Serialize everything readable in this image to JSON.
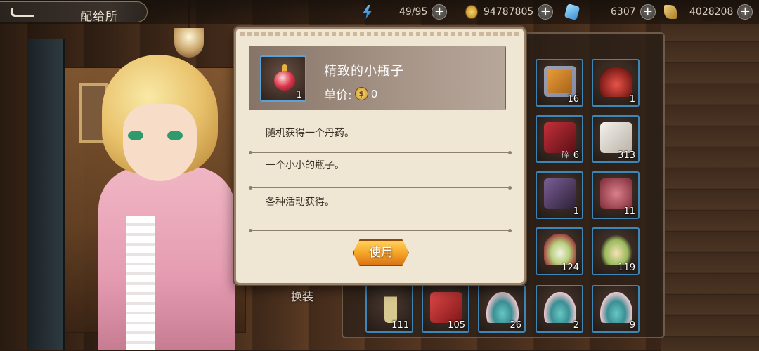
{
  "topbar": {
    "title": "配给所",
    "energy": "49/95",
    "coins": "94787805",
    "gems": "6307",
    "tokens": "4028208"
  },
  "popup": {
    "item_name": "精致的小瓶子",
    "item_qty": "1",
    "price_label": "单价:",
    "price_value": "0",
    "descriptions": [
      "随机获得一个丹药。",
      "一个小小的瓶子。",
      "各种活动获得。"
    ],
    "use_label": "使用"
  },
  "change_outfit_label": "换装",
  "inventory": [
    {
      "icon": "gift-box-icon",
      "count": "16"
    },
    {
      "icon": "potion-bottle-icon",
      "count": "1"
    },
    {
      "icon": "red-package-icon",
      "count": "6",
      "tag": "碎"
    },
    {
      "icon": "dice-icon",
      "count": "313"
    },
    {
      "icon": "blade-icon",
      "count": "1"
    },
    {
      "icon": "gourd-icon",
      "count": "11"
    },
    {
      "icon": "salad-plate-icon",
      "count": "124"
    },
    {
      "icon": "feast-plate-icon",
      "count": "119"
    },
    {
      "icon": "vial-icon",
      "count": "111"
    },
    {
      "icon": "red-scroll-icon",
      "count": "105"
    },
    {
      "icon": "lotus-icon",
      "count": "26"
    },
    {
      "icon": "lotus-icon",
      "count": "2"
    },
    {
      "icon": "lotus-icon",
      "count": "9"
    }
  ]
}
